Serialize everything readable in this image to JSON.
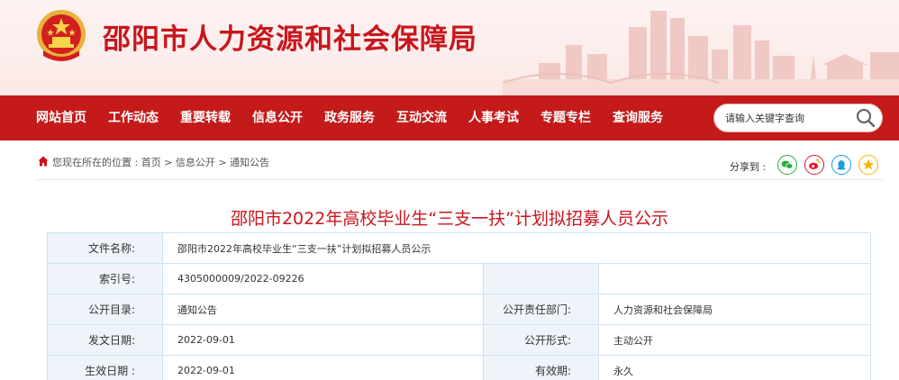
{
  "header": {
    "site_title": "邵阳市人力资源和社会保障局"
  },
  "nav": {
    "items": [
      {
        "label": "网站首页"
      },
      {
        "label": "工作动态"
      },
      {
        "label": "重要转载"
      },
      {
        "label": "信息公开"
      },
      {
        "label": "政务服务"
      },
      {
        "label": "互动交流"
      },
      {
        "label": "人事考试"
      },
      {
        "label": "专题专栏"
      },
      {
        "label": "查询服务"
      }
    ],
    "search_placeholder": "请输入关键字查询"
  },
  "breadcrumb": {
    "prefix": "您现在所在的位置 : ",
    "items": [
      "首页",
      "信息公开",
      "通知公告"
    ],
    "separator": " > "
  },
  "share": {
    "label": "分享到 :",
    "targets": [
      "wechat-icon",
      "weibo-icon",
      "qq-icon",
      "qzone-icon"
    ],
    "colors": [
      "#2bad3a",
      "#e6162d",
      "#1a9ee0",
      "#f4b400"
    ]
  },
  "article": {
    "title": "邵阳市2022年高校毕业生“三支一扶”计划拟招募人员公示"
  },
  "info": {
    "file_name_label": "文件名称:",
    "file_name": "邵阳市2022年高校毕业生“三支一扶”计划拟招募人员公示",
    "index_label": "索引号:",
    "index": "4305000009/2022-09226",
    "catalog_label": "公开目录:",
    "catalog": "通知公告",
    "dept_label": "公开责任部门:",
    "dept": "人力资源和社会保障局",
    "issue_date_label": "发文日期:",
    "issue_date": "2022-09-01",
    "form_label": "公开形式:",
    "form": "主动公开",
    "effective_date_label": "生效日期 :",
    "effective_date": "2022-09-01",
    "validity_label": "有效期:",
    "validity": "永久"
  }
}
